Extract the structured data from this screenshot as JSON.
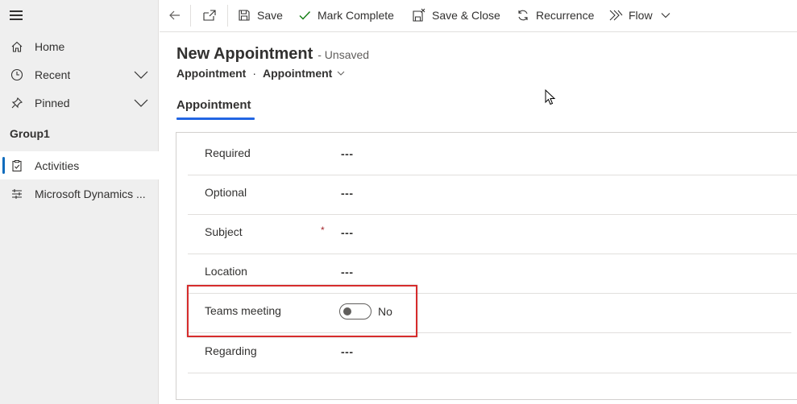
{
  "sidebar": {
    "items": [
      {
        "label": "Home",
        "icon": "home-icon"
      },
      {
        "label": "Recent",
        "icon": "clock-icon",
        "expandable": true
      },
      {
        "label": "Pinned",
        "icon": "pin-icon",
        "expandable": true
      }
    ],
    "group_title": "Group1",
    "group_items": [
      {
        "label": "Activities",
        "icon": "clipboard-icon",
        "active": true
      },
      {
        "label": "Microsoft Dynamics ...",
        "icon": "dynamics-icon",
        "active": false
      }
    ]
  },
  "toolbar": {
    "save": "Save",
    "mark_complete": "Mark Complete",
    "save_close": "Save & Close",
    "recurrence": "Recurrence",
    "flow": "Flow"
  },
  "header": {
    "title": "New Appointment",
    "status": "- Unsaved",
    "breadcrumb_entity": "Appointment",
    "breadcrumb_separator": "·",
    "breadcrumb_form": "Appointment"
  },
  "tabs": [
    {
      "label": "Appointment"
    }
  ],
  "form": {
    "fields": [
      {
        "label": "Required",
        "value": "---"
      },
      {
        "label": "Optional",
        "value": "---"
      },
      {
        "label": "Subject",
        "value": "---",
        "required": "*"
      },
      {
        "label": "Location",
        "value": "---"
      },
      {
        "label": "Teams meeting",
        "value": "No"
      },
      {
        "label": "Regarding",
        "value": "---"
      }
    ]
  },
  "colors": {
    "accent": "#2266e3",
    "active_indicator": "#0f6cbd",
    "highlight": "#d62c2c",
    "required": "#a4262c"
  }
}
